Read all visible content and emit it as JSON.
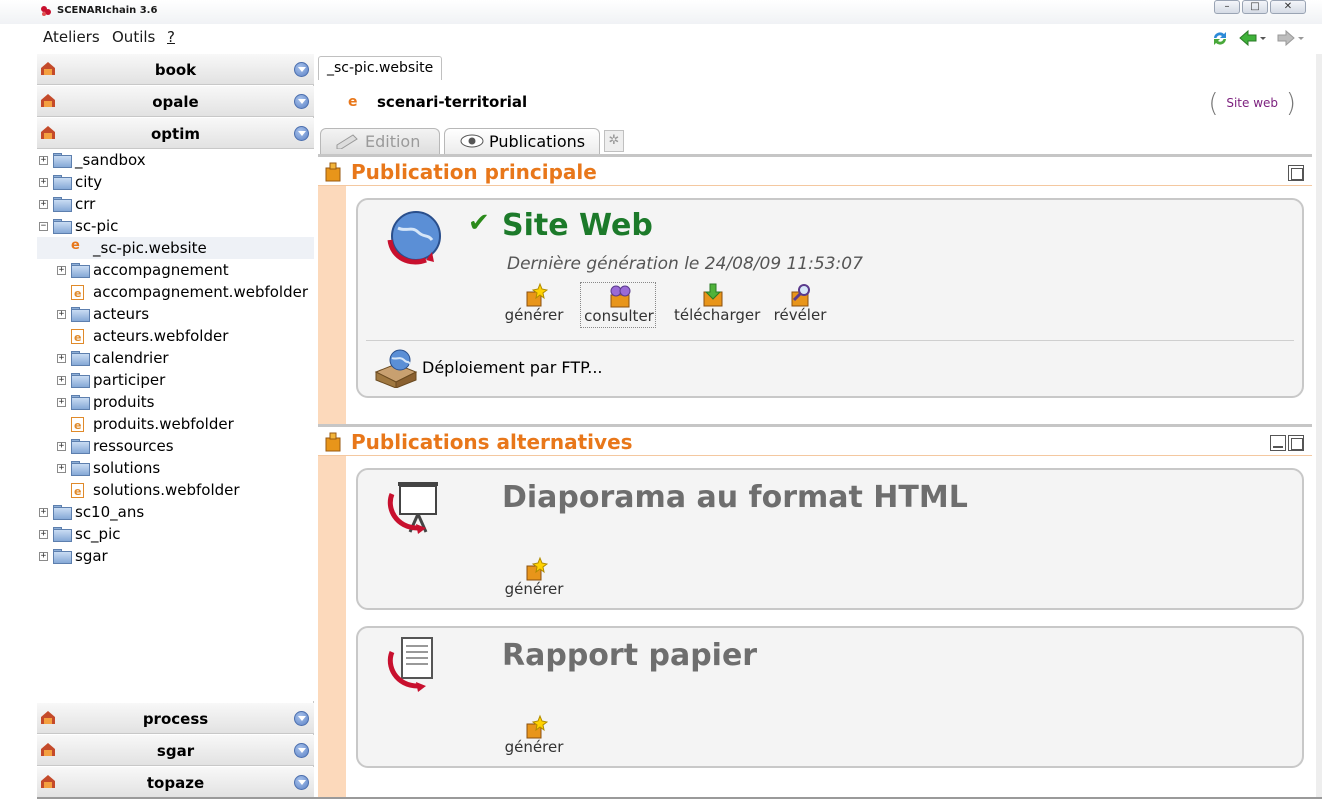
{
  "app": {
    "title": "SCENARIchain 3.6"
  },
  "menu": {
    "items": [
      "Ateliers",
      "Outils",
      "?"
    ]
  },
  "toolbar": {
    "icons": [
      "refresh-icon",
      "back-arrow-icon",
      "forward-arrow-icon"
    ]
  },
  "workspaces_top": [
    {
      "label": "book"
    },
    {
      "label": "opale"
    },
    {
      "label": "optim"
    }
  ],
  "workspaces_bottom": [
    {
      "label": "process"
    },
    {
      "label": "sgar"
    },
    {
      "label": "topaze"
    }
  ],
  "tree": [
    {
      "label": "_sandbox",
      "type": "folder",
      "level": 0,
      "expander": "+"
    },
    {
      "label": "city",
      "type": "folder",
      "level": 0,
      "expander": "+"
    },
    {
      "label": "crr",
      "type": "folder",
      "level": 0,
      "expander": "+"
    },
    {
      "label": "sc-pic",
      "type": "folder-open",
      "level": 0,
      "expander": "−"
    },
    {
      "label": "_sc-pic.website",
      "type": "item",
      "level": 1,
      "expander": "",
      "selected": true
    },
    {
      "label": "accompagnement",
      "type": "folder",
      "level": 1,
      "expander": "+"
    },
    {
      "label": "accompagnement.webfolder",
      "type": "webfolder",
      "level": 1,
      "expander": ""
    },
    {
      "label": "acteurs",
      "type": "folder",
      "level": 1,
      "expander": "+"
    },
    {
      "label": "acteurs.webfolder",
      "type": "webfolder",
      "level": 1,
      "expander": ""
    },
    {
      "label": "calendrier",
      "type": "folder",
      "level": 1,
      "expander": "+"
    },
    {
      "label": "participer",
      "type": "folder",
      "level": 1,
      "expander": "+"
    },
    {
      "label": "produits",
      "type": "folder",
      "level": 1,
      "expander": "+"
    },
    {
      "label": "produits.webfolder",
      "type": "webfolder",
      "level": 1,
      "expander": ""
    },
    {
      "label": "ressources",
      "type": "folder",
      "level": 1,
      "expander": "+"
    },
    {
      "label": "solutions",
      "type": "folder",
      "level": 1,
      "expander": "+"
    },
    {
      "label": "solutions.webfolder",
      "type": "webfolder",
      "level": 1,
      "expander": ""
    },
    {
      "label": "sc10_ans",
      "type": "folder",
      "level": 0,
      "expander": "+"
    },
    {
      "label": "sc_pic",
      "type": "folder",
      "level": 0,
      "expander": "+"
    },
    {
      "label": "sgar",
      "type": "folder",
      "level": 0,
      "expander": "+"
    }
  ],
  "doc": {
    "tab_label": "_sc-pic.website",
    "title": "scenari-territorial",
    "site_web_link": "Site web"
  },
  "view_tabs": {
    "edition": "Edition",
    "publications": "Publications",
    "add": "✲"
  },
  "main_publication": {
    "section_title": "Publication principale",
    "title": "Site Web",
    "last_generation": "Dernière génération le 24/08/09 11:53:07",
    "actions": [
      "générer",
      "consulter",
      "télécharger",
      "révéler"
    ],
    "deploy_label": "Déploiement par FTP..."
  },
  "alt_publications": {
    "section_title": "Publications alternatives",
    "items": [
      {
        "title": "Diaporama au format HTML",
        "action": "générer"
      },
      {
        "title": "Rapport papier",
        "action": "générer"
      }
    ]
  },
  "colors": {
    "accent_orange": "#e8771a",
    "success_green": "#1c7a2a",
    "link_purple": "#7b1f7d"
  }
}
